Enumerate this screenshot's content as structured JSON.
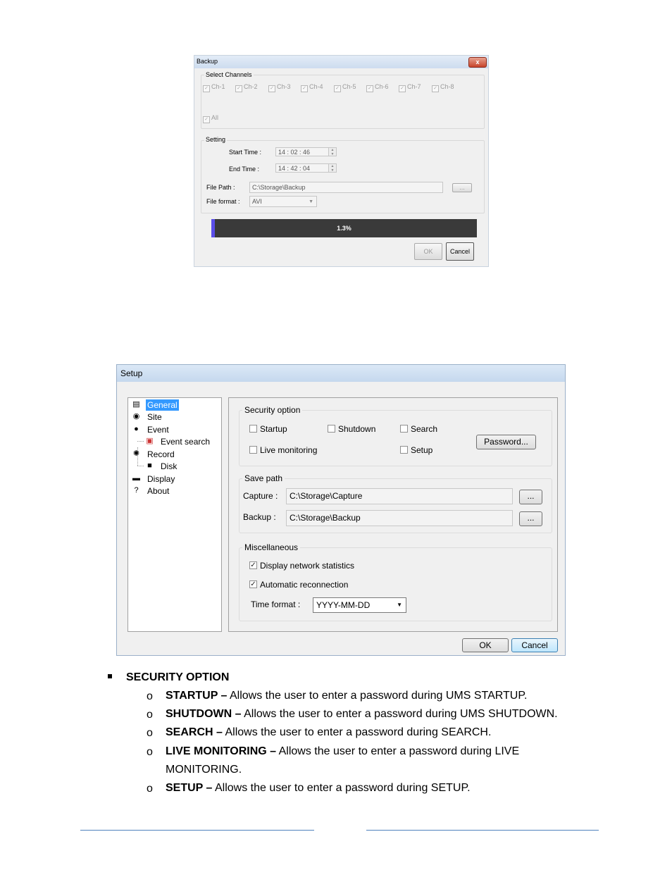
{
  "backup": {
    "title": "Backup",
    "close": "x",
    "select_channels": "Select Channels",
    "channels": [
      "Ch-1",
      "Ch-2",
      "Ch-3",
      "Ch-4",
      "Ch-5",
      "Ch-6",
      "Ch-7",
      "Ch-8"
    ],
    "all": "All",
    "setting": "Setting",
    "start_label": "Start Time :",
    "start_value": "14 : 02 : 46",
    "end_label": "End Time  :",
    "end_value": "14 : 42 : 04",
    "path_label": "File Path :",
    "path_value": "C:\\Storage\\Backup",
    "browse": "...",
    "format_label": "File format :",
    "format_value": "AVI",
    "progress_text": "1.3%",
    "progress": 0.013,
    "ok": "OK",
    "cancel": "Cancel"
  },
  "setup": {
    "title": "Setup",
    "tree": [
      "General",
      "Site",
      "Event",
      "Event search",
      "Record",
      "Disk",
      "Display",
      "About"
    ],
    "security": {
      "title": "Security option",
      "startup": "Startup",
      "shutdown": "Shutdown",
      "search": "Search",
      "live": "Live monitoring",
      "setup": "Setup",
      "password": "Password..."
    },
    "save_path": {
      "title": "Save path",
      "capture_label": "Capture :",
      "capture_value": "C:\\Storage\\Capture",
      "backup_label": "Backup :",
      "backup_value": "C:\\Storage\\Backup",
      "browse": "..."
    },
    "misc": {
      "title": "Miscellaneous",
      "net_stats": "Display network statistics",
      "auto_reconnect": "Automatic reconnection",
      "time_format_label": "Time format :",
      "time_format_value": "YYYY-MM-DD"
    },
    "ok": "OK",
    "cancel": "Cancel"
  },
  "doc": {
    "heading": "SECURITY OPTION",
    "items": [
      {
        "term": "STARTUP –",
        "text": " Allows the user to enter a password during UMS STARTUP."
      },
      {
        "term": "SHUTDOWN –",
        "text": " Allows the user to enter a password during UMS SHUTDOWN."
      },
      {
        "term": "SEARCH –",
        "text": " Allows the user to enter a password during SEARCH."
      },
      {
        "term": "LIVE MONITORING –",
        "text": " Allows the user to enter a password during LIVE",
        "text2": "MONITORING."
      },
      {
        "term": "SETUP –",
        "text": " Allows the user to enter a password during SETUP."
      }
    ],
    "bullet_marker": "o"
  }
}
